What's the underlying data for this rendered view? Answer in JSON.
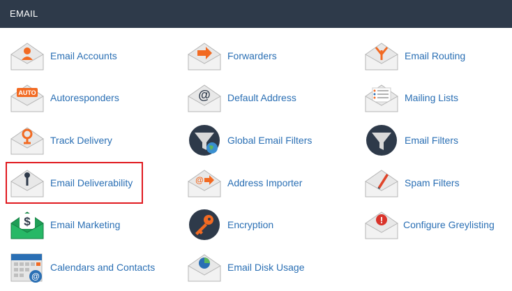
{
  "section": {
    "title": "EMAIL"
  },
  "colors": {
    "header_bg": "#2e3a4a",
    "link": "#2a6fb4",
    "accent_orange": "#f26a22",
    "highlight_border": "#e0191f"
  },
  "items": [
    {
      "label": "Email Accounts",
      "icon": "envelope-user-icon"
    },
    {
      "label": "Forwarders",
      "icon": "envelope-arrow-icon"
    },
    {
      "label": "Email Routing",
      "icon": "envelope-routing-icon"
    },
    {
      "label": "Autoresponders",
      "icon": "envelope-auto-icon",
      "icon_text": "AUTO"
    },
    {
      "label": "Default Address",
      "icon": "envelope-at-icon",
      "icon_text": "@"
    },
    {
      "label": "Mailing Lists",
      "icon": "envelope-list-icon"
    },
    {
      "label": "Track Delivery",
      "icon": "envelope-location-icon"
    },
    {
      "label": "Global Email Filters",
      "icon": "funnel-globe-icon"
    },
    {
      "label": "Email Filters",
      "icon": "funnel-icon"
    },
    {
      "label": "Email Deliverability",
      "icon": "envelope-key-icon"
    },
    {
      "label": "Address Importer",
      "icon": "envelope-import-icon",
      "icon_text": "@"
    },
    {
      "label": "Spam Filters",
      "icon": "envelope-pen-icon"
    },
    {
      "label": "Email Marketing",
      "icon": "envelope-dollar-icon",
      "icon_text": "$"
    },
    {
      "label": "Encryption",
      "icon": "key-circle-icon"
    },
    {
      "label": "Configure Greylisting",
      "icon": "envelope-alert-icon",
      "icon_text": "!"
    },
    {
      "label": "Calendars and Contacts",
      "icon": "calendar-icon",
      "icon_text": "@"
    },
    {
      "label": "Email Disk Usage",
      "icon": "envelope-pie-icon"
    }
  ]
}
